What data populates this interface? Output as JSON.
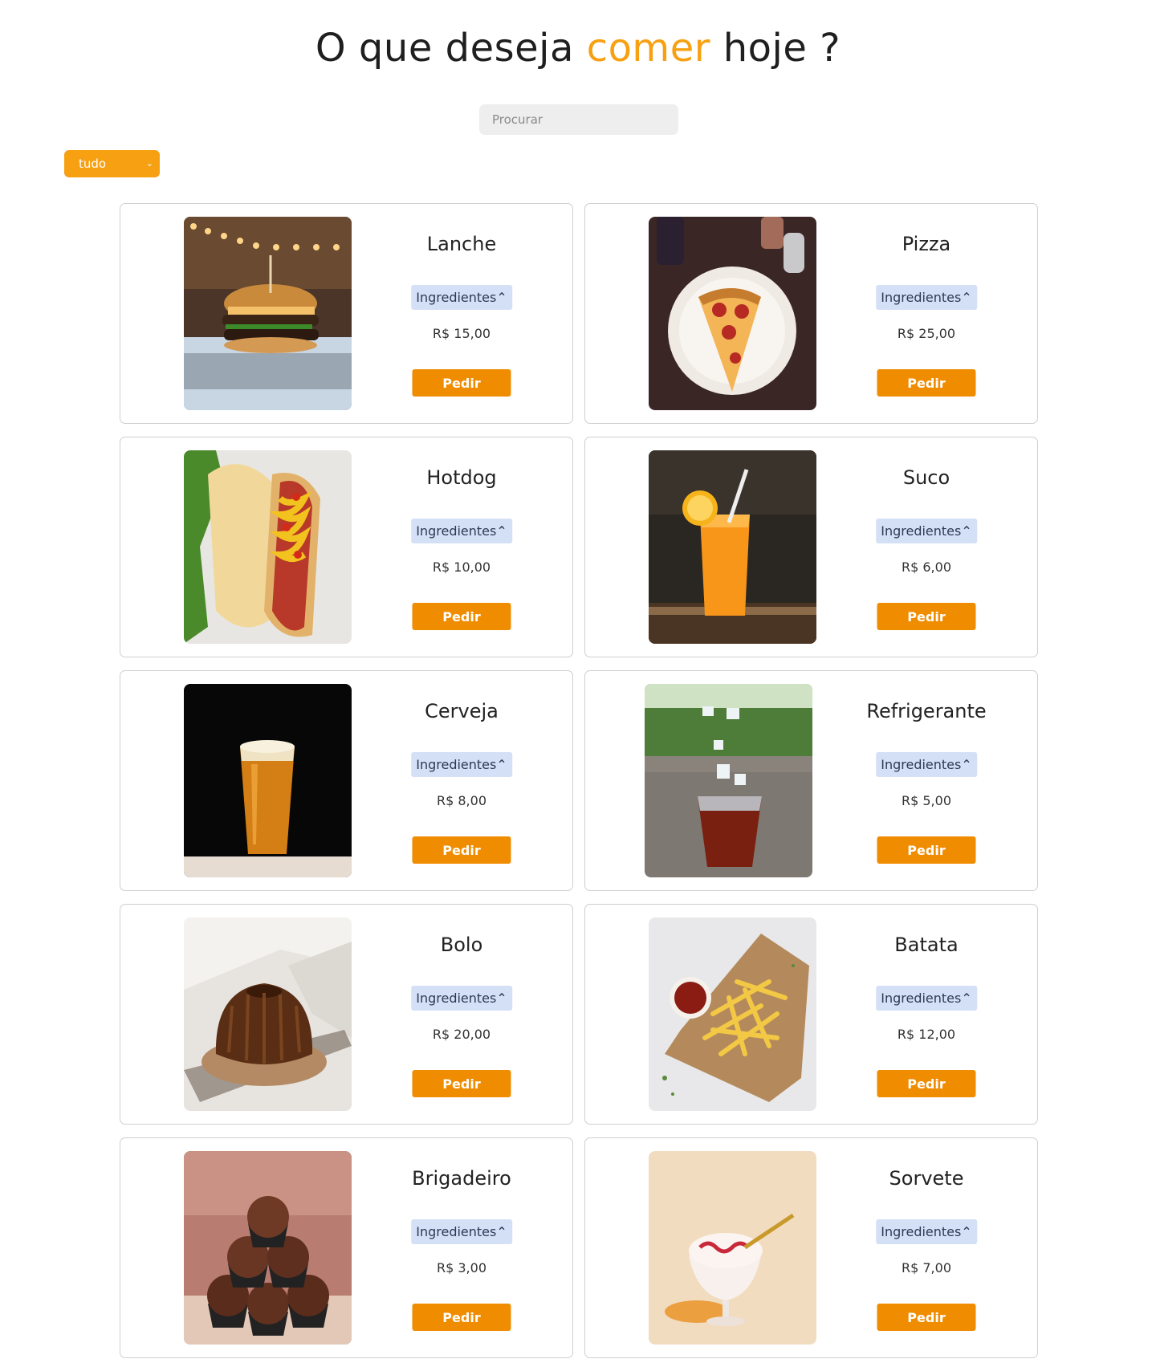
{
  "header": {
    "title_before": "O que deseja",
    "title_accent": "comer",
    "title_after": "hoje ?"
  },
  "search": {
    "placeholder": "Procurar",
    "value": ""
  },
  "filter": {
    "selected": "tudo"
  },
  "colors": {
    "accent": "#f7a012",
    "button": "#f08c00",
    "ingredients_bg": "#d4e0f5"
  },
  "products": [
    {
      "name": "Lanche",
      "ingredients_label": "Ingredientes",
      "price": "R$ 15,00",
      "order_label": "Pedir",
      "image": "burger"
    },
    {
      "name": "Pizza",
      "ingredients_label": "Ingredientes",
      "price": "R$ 25,00",
      "order_label": "Pedir",
      "image": "pizza-slice"
    },
    {
      "name": "Hotdog",
      "ingredients_label": "Ingredientes",
      "price": "R$ 10,00",
      "order_label": "Pedir",
      "image": "hotdog"
    },
    {
      "name": "Suco",
      "ingredients_label": "Ingredientes",
      "price": "R$ 6,00",
      "order_label": "Pedir",
      "image": "orange-juice"
    },
    {
      "name": "Cerveja",
      "ingredients_label": "Ingredientes",
      "price": "R$ 8,00",
      "order_label": "Pedir",
      "image": "beer-glass"
    },
    {
      "name": "Refrigerante",
      "ingredients_label": "Ingredientes",
      "price": "R$ 5,00",
      "order_label": "Pedir",
      "image": "soda-cup"
    },
    {
      "name": "Bolo",
      "ingredients_label": "Ingredientes",
      "price": "R$ 20,00",
      "order_label": "Pedir",
      "image": "chocolate-cake"
    },
    {
      "name": "Batata",
      "ingredients_label": "Ingredientes",
      "price": "R$ 12,00",
      "order_label": "Pedir",
      "image": "french-fries"
    },
    {
      "name": "Brigadeiro",
      "ingredients_label": "Ingredientes",
      "price": "R$ 3,00",
      "order_label": "Pedir",
      "image": "brigadeiros"
    },
    {
      "name": "Sorvete",
      "ingredients_label": "Ingredientes",
      "price": "R$ 7,00",
      "order_label": "Pedir",
      "image": "ice-cream"
    }
  ]
}
